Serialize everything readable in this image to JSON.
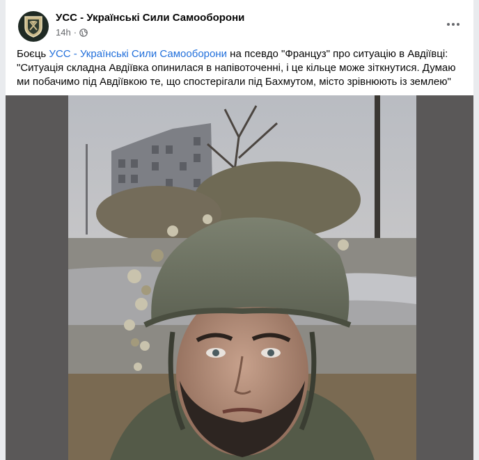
{
  "post": {
    "page_name": "УСС - Українські Сили Самооборони",
    "time": "14h",
    "privacy_icon": "globe-icon",
    "more_icon": "more-horizontal-icon",
    "text_prefix": "Боєць ",
    "text_link": "УСС - Українські Сили Самооборони",
    "text_body": " на псевдо \"Француз\"  про ситуацію в Авдіївці: \"Ситуація складна Авдіївка опинилася в напівоточенні, і це кільце може зіткнутися. Думаю ми побачимо під Авдіївкою те, що спостерігали під Бахмутом, місто зрівнюють із землею\""
  },
  "colors": {
    "link": "#216fdb",
    "meta": "#65676b",
    "media_background": "#5a5858"
  }
}
